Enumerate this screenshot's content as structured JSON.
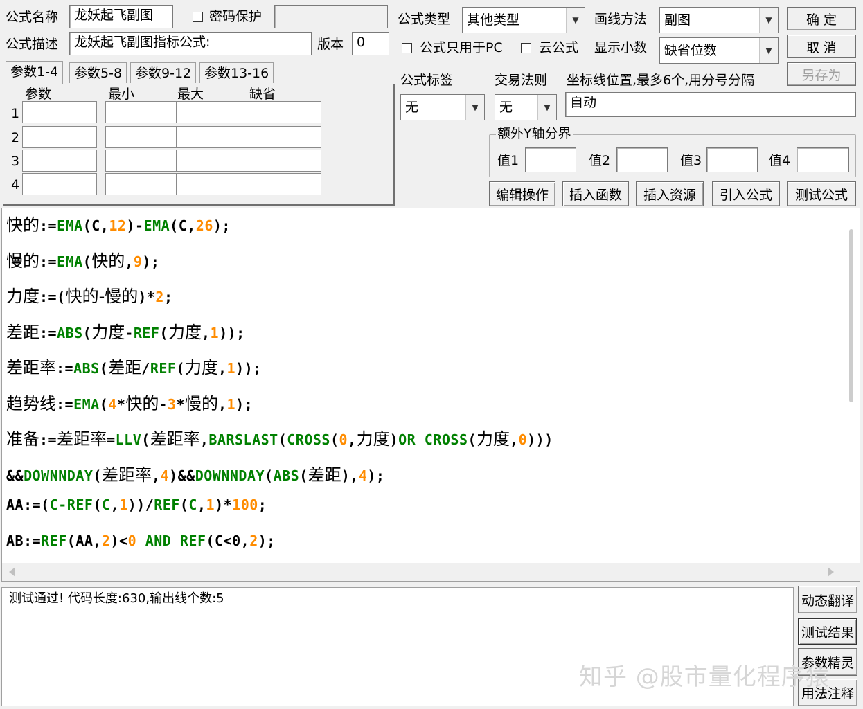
{
  "top": {
    "name_label": "公式名称",
    "name_value": "龙妖起飞副图",
    "password_label": "密码保护",
    "password_value": "",
    "desc_label": "公式描述",
    "desc_value": "龙妖起飞副图指标公式:",
    "version_label": "版本",
    "version_value": "0",
    "type_label": "公式类型",
    "type_value": "其他类型",
    "draw_label": "画线方法",
    "draw_value": "副图",
    "pc_only_label": "公式只用于PC",
    "cloud_label": "云公式",
    "decimal_label": "显示小数",
    "decimal_value": "缺省位数",
    "ok_label": "确  定",
    "cancel_label": "取  消",
    "saveas_label": "另存为"
  },
  "params": {
    "tabs": [
      "参数1-4",
      "参数5-8",
      "参数9-12",
      "参数13-16"
    ],
    "headers": [
      "参数",
      "最小",
      "最大",
      "缺省"
    ],
    "rows": [
      "1",
      "2",
      "3",
      "4"
    ]
  },
  "meta": {
    "tag_label": "公式标签",
    "tag_value": "无",
    "rule_label": "交易法则",
    "rule_value": "无",
    "axis_label": "坐标线位置,最多6个,用分号分隔",
    "axis_value": "自动",
    "yaxis_group": "额外Y轴分界",
    "v1": "值1",
    "v2": "值2",
    "v3": "值3",
    "v4": "值4"
  },
  "actions": {
    "edit": "编辑操作",
    "insert_fn": "插入函数",
    "insert_res": "插入资源",
    "import": "引入公式",
    "test": "测试公式"
  },
  "code_lines": [
    [
      [
        "id",
        "快的"
      ],
      [
        "op",
        ":="
      ],
      [
        "fn",
        "EMA"
      ],
      [
        "op",
        "(C,"
      ],
      [
        "num",
        "12"
      ],
      [
        "op",
        ")-"
      ],
      [
        "fn",
        "EMA"
      ],
      [
        "op",
        "(C,"
      ],
      [
        "num",
        "26"
      ],
      [
        "op",
        ");"
      ]
    ],
    [
      [
        "id",
        "慢的"
      ],
      [
        "op",
        ":="
      ],
      [
        "fn",
        "EMA"
      ],
      [
        "op",
        "("
      ],
      [
        "id",
        "快的"
      ],
      [
        "op",
        ","
      ],
      [
        "num",
        "9"
      ],
      [
        "op",
        ");"
      ]
    ],
    [
      [
        "id",
        "力度"
      ],
      [
        "op",
        ":=("
      ],
      [
        "id",
        "快的-慢的"
      ],
      [
        "op",
        ")*"
      ],
      [
        "num",
        "2"
      ],
      [
        "op",
        ";"
      ]
    ],
    [
      [
        "id",
        "差距"
      ],
      [
        "op",
        ":="
      ],
      [
        "fn",
        "ABS"
      ],
      [
        "op",
        "("
      ],
      [
        "id",
        "力度"
      ],
      [
        "op",
        "-"
      ],
      [
        "fn",
        "REF"
      ],
      [
        "op",
        "("
      ],
      [
        "id",
        "力度"
      ],
      [
        "op",
        ","
      ],
      [
        "num",
        "1"
      ],
      [
        "op",
        "));"
      ]
    ],
    [
      [
        "id",
        "差距率"
      ],
      [
        "op",
        ":="
      ],
      [
        "fn",
        "ABS"
      ],
      [
        "op",
        "("
      ],
      [
        "id",
        "差距"
      ],
      [
        "op",
        "/"
      ],
      [
        "fn",
        "REF"
      ],
      [
        "op",
        "("
      ],
      [
        "id",
        "力度"
      ],
      [
        "op",
        ","
      ],
      [
        "num",
        "1"
      ],
      [
        "op",
        "));"
      ]
    ],
    [
      [
        "id",
        "趋势线"
      ],
      [
        "op",
        ":="
      ],
      [
        "fn",
        "EMA"
      ],
      [
        "op",
        "("
      ],
      [
        "num",
        "4"
      ],
      [
        "op",
        "*"
      ],
      [
        "id",
        "快的"
      ],
      [
        "op",
        "-"
      ],
      [
        "num",
        "3"
      ],
      [
        "op",
        "*"
      ],
      [
        "id",
        "慢的"
      ],
      [
        "op",
        ","
      ],
      [
        "num",
        "1"
      ],
      [
        "op",
        ");"
      ]
    ],
    [
      [
        "id",
        "准备"
      ],
      [
        "op",
        ":="
      ],
      [
        "id",
        "差距率"
      ],
      [
        "op",
        "="
      ],
      [
        "fn",
        "LLV"
      ],
      [
        "op",
        "("
      ],
      [
        "id",
        "差距率"
      ],
      [
        "op",
        ","
      ],
      [
        "fn",
        "BARSLAST"
      ],
      [
        "op",
        "("
      ],
      [
        "fn",
        "CROSS"
      ],
      [
        "op",
        "("
      ],
      [
        "num",
        "0"
      ],
      [
        "op",
        ","
      ],
      [
        "id",
        "力度"
      ],
      [
        "op",
        ")"
      ],
      [
        "fn",
        "OR"
      ],
      [
        "op",
        " "
      ],
      [
        "fn",
        "CROSS"
      ],
      [
        "op",
        "("
      ],
      [
        "id",
        "力度"
      ],
      [
        "op",
        ","
      ],
      [
        "num",
        "0"
      ],
      [
        "op",
        ")))"
      ]
    ],
    [
      [
        "op",
        "&&"
      ],
      [
        "fn",
        "DOWNNDAY"
      ],
      [
        "op",
        "("
      ],
      [
        "id",
        "差距率"
      ],
      [
        "op",
        ","
      ],
      [
        "num",
        "4"
      ],
      [
        "op",
        ")&&"
      ],
      [
        "fn",
        "DOWNNDAY"
      ],
      [
        "op",
        "("
      ],
      [
        "fn",
        "ABS"
      ],
      [
        "op",
        "("
      ],
      [
        "id",
        "差距"
      ],
      [
        "op",
        "),"
      ],
      [
        "num",
        "4"
      ],
      [
        "op",
        ");"
      ]
    ],
    [
      [
        "op",
        "AA:=("
      ],
      [
        "fn",
        "C-REF"
      ],
      [
        "op",
        "("
      ],
      [
        "fn",
        "C"
      ],
      [
        "op",
        ","
      ],
      [
        "num",
        "1"
      ],
      [
        "op",
        "))/"
      ],
      [
        "fn",
        "REF"
      ],
      [
        "op",
        "("
      ],
      [
        "fn",
        "C"
      ],
      [
        "op",
        ","
      ],
      [
        "num",
        "1"
      ],
      [
        "op",
        ")*"
      ],
      [
        "num",
        "100"
      ],
      [
        "op",
        ";"
      ]
    ],
    [
      [
        "op",
        "AB:="
      ],
      [
        "fn",
        "REF"
      ],
      [
        "op",
        "(AA,"
      ],
      [
        "num",
        "2"
      ],
      [
        "op",
        ")<"
      ],
      [
        "num",
        "0"
      ],
      [
        "op",
        " "
      ],
      [
        "fn",
        "AND"
      ],
      [
        "op",
        " "
      ],
      [
        "fn",
        "REF"
      ],
      [
        "op",
        "(C<0,"
      ],
      [
        "num",
        "2"
      ],
      [
        "op",
        ");"
      ]
    ]
  ],
  "output_text": "测试通过! 代码长度:630,输出线个数:5",
  "side_buttons": [
    "动态翻译",
    "测试结果",
    "参数精灵",
    "用法注释"
  ],
  "watermark": "知乎 @股市量化程序猿"
}
